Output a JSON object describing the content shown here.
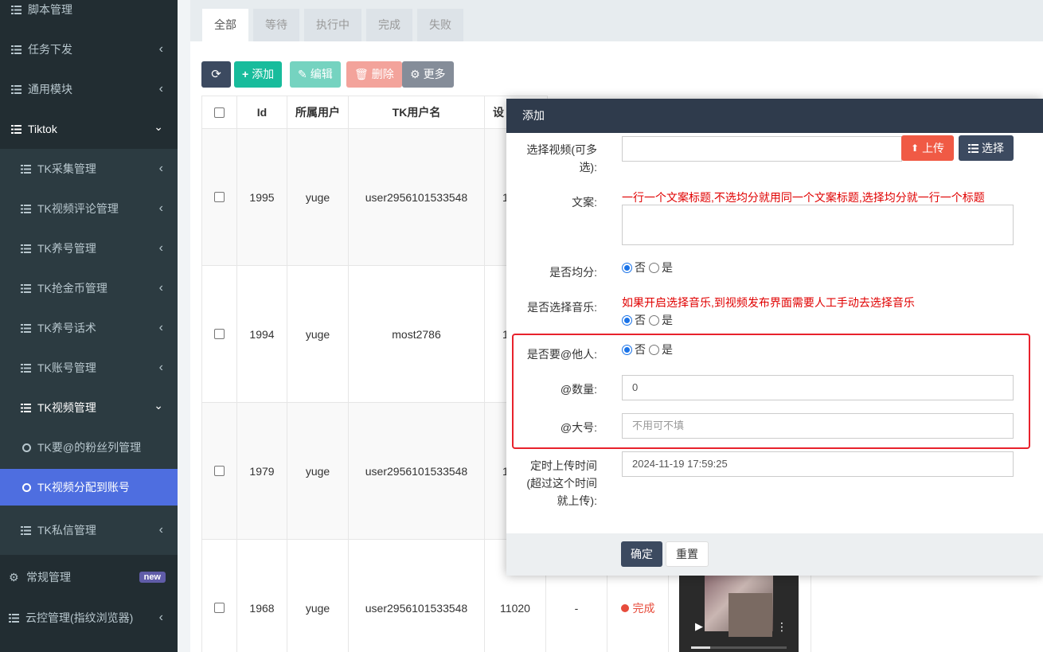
{
  "sidebar": {
    "items": [
      {
        "label": "脚本管理",
        "icon": "list-icon",
        "arrow": ""
      },
      {
        "label": "任务下发",
        "icon": "list-icon",
        "arrow": "left"
      },
      {
        "label": "通用模块",
        "icon": "list-icon",
        "arrow": "left"
      },
      {
        "label": "Tiktok",
        "icon": "list-icon",
        "arrow": "down"
      },
      {
        "label": "TK采集管理",
        "icon": "list-icon",
        "arrow": "left"
      },
      {
        "label": "TK视频评论管理",
        "icon": "list-icon",
        "arrow": "left"
      },
      {
        "label": "TK养号管理",
        "icon": "list-icon",
        "arrow": "left"
      },
      {
        "label": "TK抢金币管理",
        "icon": "list-icon",
        "arrow": "left"
      },
      {
        "label": "TK养号话术",
        "icon": "list-icon",
        "arrow": "left"
      },
      {
        "label": "TK账号管理",
        "icon": "list-icon",
        "arrow": "left"
      },
      {
        "label": "TK视频管理",
        "icon": "list-icon",
        "arrow": "down"
      },
      {
        "label": "TK要@的粉丝列管理",
        "icon": "circle-icon",
        "arrow": ""
      },
      {
        "label": "TK视频分配到账号",
        "icon": "circle-icon",
        "arrow": ""
      },
      {
        "label": "TK私信管理",
        "icon": "list-icon",
        "arrow": "left"
      },
      {
        "label": "常规管理",
        "icon": "gears-icon",
        "badge": "new"
      },
      {
        "label": "云控管理(指纹浏览器)",
        "icon": "list-icon",
        "arrow": "left"
      }
    ]
  },
  "tabs": [
    "全部",
    "等待",
    "执行中",
    "完成",
    "失败"
  ],
  "toolbar": {
    "refresh": "",
    "add": "添加",
    "edit": "编辑",
    "delete": "删除",
    "more": "更多"
  },
  "table": {
    "headers": [
      "Id",
      "所属用户",
      "TK用户名",
      "设"
    ],
    "rows": [
      {
        "id": "1995",
        "user": "yuge",
        "tk": "user2956101533548",
        "dev": "1"
      },
      {
        "id": "1994",
        "user": "yuge",
        "tk": "most2786",
        "dev": "1"
      },
      {
        "id": "1979",
        "user": "yuge",
        "tk": "user2956101533548",
        "dev": "1"
      },
      {
        "id": "1968",
        "user": "yuge",
        "tk": "user2956101533548",
        "dev": "11020",
        "dash": "-",
        "status": "完成"
      }
    ]
  },
  "modal": {
    "title": "添加",
    "video_label": "选择视频(可多选):",
    "upload_btn": "上传",
    "choose_btn": "选择",
    "copy_label": "文案:",
    "copy_hint": "一行一个文案标题,不选均分就用同一个文案标题,选择均分就一行一个标题",
    "split_label": "是否均分:",
    "music_label": "是否选择音乐:",
    "music_hint": "如果开启选择音乐,到视频发布界面需要人工手动去选择音乐",
    "at_label": "是否要@他人:",
    "count_label": "@数量:",
    "count_value": "0",
    "big_label": "@大号:",
    "big_placeholder": "不用可不填",
    "time_label": "定时上传时间(超过这个时间就上传):",
    "time_value": "2024-11-19 17:59:25",
    "no": "否",
    "yes": "是",
    "confirm": "确定",
    "reset": "重置"
  },
  "colors": {
    "sidebar_bg": "#222d32",
    "active_bg": "#4e6ee0",
    "modal_header": "#2f3b4c",
    "highlight_border": "#e8222c"
  }
}
